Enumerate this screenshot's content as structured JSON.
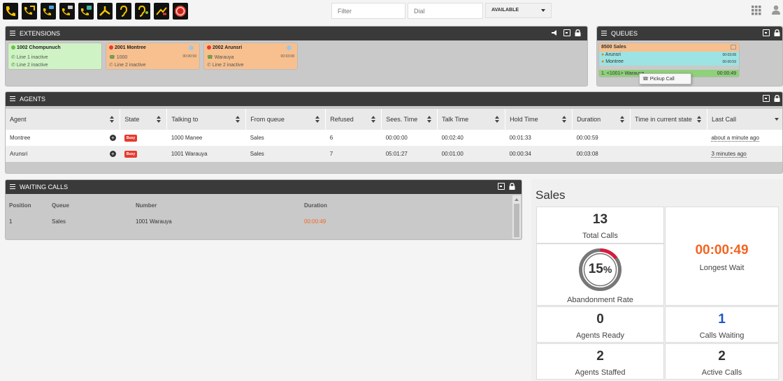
{
  "toolbar": {
    "buttons": [
      "phone-icon",
      "transfer-call-icon",
      "conference-icon",
      "attended-transfer-icon",
      "park-call-icon",
      "split-call-icon",
      "listen-icon",
      "whisper-icon",
      "hangup-icon",
      "record-icon"
    ],
    "filter_placeholder": "Filter",
    "dial_placeholder": "Dial",
    "status": "AVAILABLE"
  },
  "extensions": {
    "title": "EXTENSIONS",
    "cards": [
      {
        "name": "1002 Chompunuch",
        "line1": "Line 1 inactive",
        "line2": "Line 2 inactive",
        "time": ""
      },
      {
        "name": "2001 Montree",
        "line1": "1000",
        "line2": "Line 2 inactive",
        "time": "00:00:59"
      },
      {
        "name": "2002 Arunsri",
        "line1": "Warauya",
        "line2": "Line 2 inactive",
        "time": "00:03:08"
      }
    ]
  },
  "queues": {
    "title": "QUEUES",
    "queue_name": "8500 Sales",
    "members": [
      {
        "name": "Arunsri",
        "time": "00:03:08"
      },
      {
        "name": "Montree",
        "time": "00:00:59"
      }
    ],
    "waiting": "1. <1001> Warauya",
    "waiting_time": "00:00:49",
    "pickup_label": "Pickup Call"
  },
  "agents": {
    "title": "AGENTS",
    "columns": [
      "Agent",
      "State",
      "Talking to",
      "From queue",
      "Refused",
      "Sees. Time",
      "Talk Time",
      "Hold Time",
      "Duration",
      "Time in current state",
      "Last Call"
    ],
    "rows": [
      {
        "agent": "Montree",
        "state": "Busy",
        "talking_to": "1000 Manee",
        "from_queue": "Sales",
        "refused": "6",
        "sees_time": "00:00:00",
        "talk_time": "00:02:40",
        "hold_time": "00:01:33",
        "duration": "00:00:59",
        "time_state": "",
        "last_call": "about a minute ago"
      },
      {
        "agent": "Arunsri",
        "state": "Busy",
        "talking_to": "1001 Warauya",
        "from_queue": "Sales",
        "refused": "7",
        "sees_time": "05:01:27",
        "talk_time": "00:01:00",
        "hold_time": "00:00:34",
        "duration": "00:03:08",
        "time_state": "",
        "last_call": "3 minutes ago"
      }
    ]
  },
  "waiting_calls": {
    "title": "WAITING CALLS",
    "columns": [
      "Position",
      "Queue",
      "Number",
      "Duration"
    ],
    "rows": [
      {
        "position": "1",
        "queue": "Sales",
        "number": "1001 Warauya",
        "duration": "00:00:49"
      }
    ]
  },
  "sales": {
    "title": "Sales",
    "total_calls": "13",
    "total_calls_label": "Total Calls",
    "longest_wait": "00:00:49",
    "longest_wait_label": "Longest Wait",
    "abandonment_rate": 15,
    "abandonment_text": "15",
    "abandonment_unit": "%",
    "abandonment_label": "Abandonment Rate",
    "agents_ready": "0",
    "agents_ready_label": "Agents Ready",
    "calls_waiting": "1",
    "calls_waiting_label": "Calls Waiting",
    "agents_staffed": "2",
    "agents_staffed_label": "Agents Staffed",
    "active_calls": "2",
    "active_calls_label": "Active Calls"
  },
  "colors": {
    "accent_orange": "#f26522",
    "busy_red": "#e53b2e",
    "calls_waiting_blue": "#1a56c7",
    "green_card": "#cff3c4",
    "orange_card": "#f7c08e",
    "queue_cyan": "#9ee3e3"
  }
}
